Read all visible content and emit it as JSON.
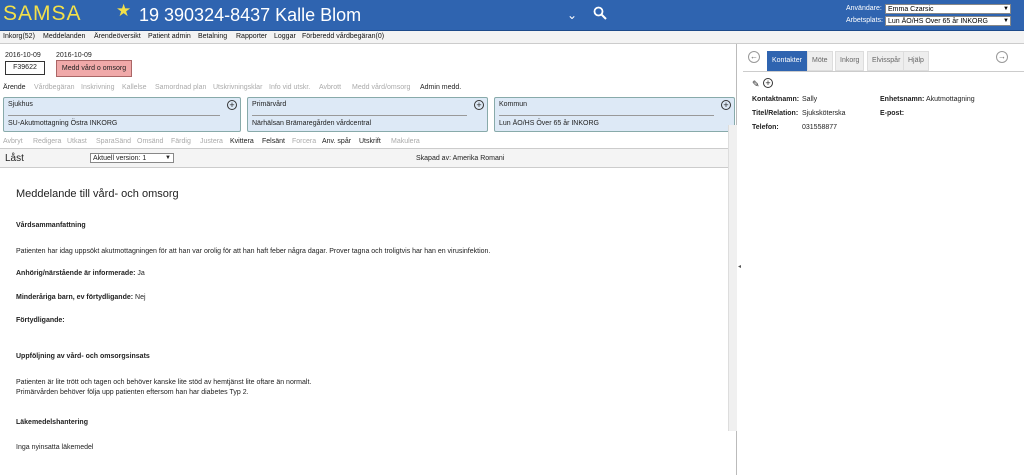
{
  "header": {
    "logo": "SAMSA",
    "patient": "19 390324-8437 Kalle Blom",
    "user_label": "Användare:",
    "user": "Emma Czarsic",
    "workplace_label": "Arbetsplats:",
    "workplace": "Lun ÄO/HS Över 65 år INKORG"
  },
  "menu": [
    "Inkorg(52)",
    "Meddelanden",
    "Ärendeöversikt",
    "Patient admin",
    "Betalning",
    "Rapporter",
    "Loggar",
    "Förberedd vårdbegäran(0)"
  ],
  "case": {
    "date1": "2016-10-09",
    "date2": "2016-10-09",
    "id": "F39622",
    "medd": "Medd vård o omsorg"
  },
  "tabs": [
    "Ärende",
    "Vårdbegäran",
    "Inskrivning",
    "Kallelse",
    "Samordnad plan",
    "Utskrivningsklar",
    "Info vid utskr.",
    "Avbrott",
    "Medd vård/omsorg",
    "Admin medd."
  ],
  "units": [
    {
      "title": "Sjukhus",
      "value": "SU-Akutmottagning Östra INKORG"
    },
    {
      "title": "Primärvård",
      "value": "Närhälsan Brämaregården vårdcentral"
    },
    {
      "title": "Kommun",
      "value": "Lun ÄO/HS Över 65 år INKORG"
    }
  ],
  "actions": [
    "Avbryt",
    "Redigera",
    "Utkast",
    "SparaSänd",
    "Omsänd",
    "Färdig",
    "Justera",
    "Kvittera",
    "Felsänt",
    "Forcera",
    "Anv. spår",
    "Utskrift",
    "Makulera"
  ],
  "status": {
    "locked": "Låst",
    "version": "Aktuell version: 1",
    "created": "Skapad av: Amerika Romani"
  },
  "document": {
    "title": "Meddelande till vård- och omsorg",
    "summary_h": "Vårdsammanfattning",
    "summary": "Patienten har idag uppsökt akutmottagningen för att han var orolig för att han haft feber några dagar. Prover tagna och troligtvis har han en virusinfektion.",
    "relative_h": "Anhörig/närstående är informerade:",
    "relative": "Ja",
    "minor_h": "Minderåriga barn, ev förtydligande:",
    "minor": "Nej",
    "clar_h": "Förtydligande:",
    "follow_h": "Uppföljning av vård- och omsorgsinsats",
    "follow1": "Patienten är lite trött och tagen och behöver kanske lite stöd av hemtjänst lite oftare än normalt.",
    "follow2": "Primärvården behöver följa upp patienten eftersom han har diabetes Typ 2.",
    "med_h": "Läkemedelshantering",
    "med": "Inga nyinsatta läkemedel"
  },
  "right": {
    "tabs": [
      "Kontakter",
      "Möte",
      "Inkorg",
      "Elvisspår",
      "Hjälp"
    ],
    "contact_name_l": "Kontaktnamn:",
    "contact_name": "Sally",
    "title_l": "Titel/Relation:",
    "title": "Sjuksköterska",
    "phone_l": "Telefon:",
    "phone": "031558877",
    "unit_l": "Enhetsnamn:",
    "unit": "Akutmottagning",
    "email_l": "E-post:"
  }
}
